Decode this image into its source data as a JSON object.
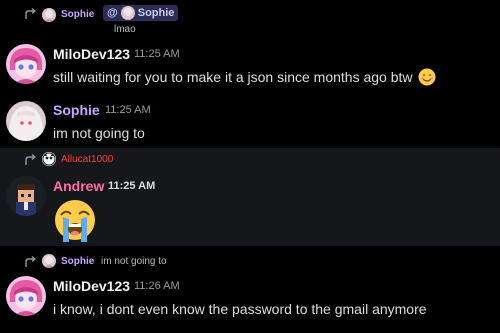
{
  "messages": [
    {
      "reply": {
        "author": "Sophie",
        "mention_prefix": "@",
        "mention_name": "Sophie",
        "text": "lmao"
      },
      "author": "MiloDev123",
      "timestamp": "11:25 AM",
      "content": "still waiting for you to make it a json since months ago btw"
    },
    {
      "author": "Sophie",
      "timestamp": "11:25 AM",
      "content": "im not going to"
    },
    {
      "reply": {
        "author": "Allucat1000"
      },
      "author": "Andrew",
      "timestamp": "11:25 AM",
      "content_emoji": "loudly-crying-face"
    },
    {
      "reply": {
        "author": "Sophie",
        "text": "im not going to"
      },
      "author": "MiloDev123",
      "timestamp": "11:26 AM",
      "content": "i know, i dont even know the password to the gmail anymore"
    }
  ],
  "colors": {
    "milodev": "#f2f3f5",
    "sophie": "#c9a6ff",
    "andrew": "#ff6fa8",
    "allucat": "#ff3b3b",
    "mention_bg": "#2b2d52",
    "background": "#000000",
    "highlight": "#16171b"
  }
}
